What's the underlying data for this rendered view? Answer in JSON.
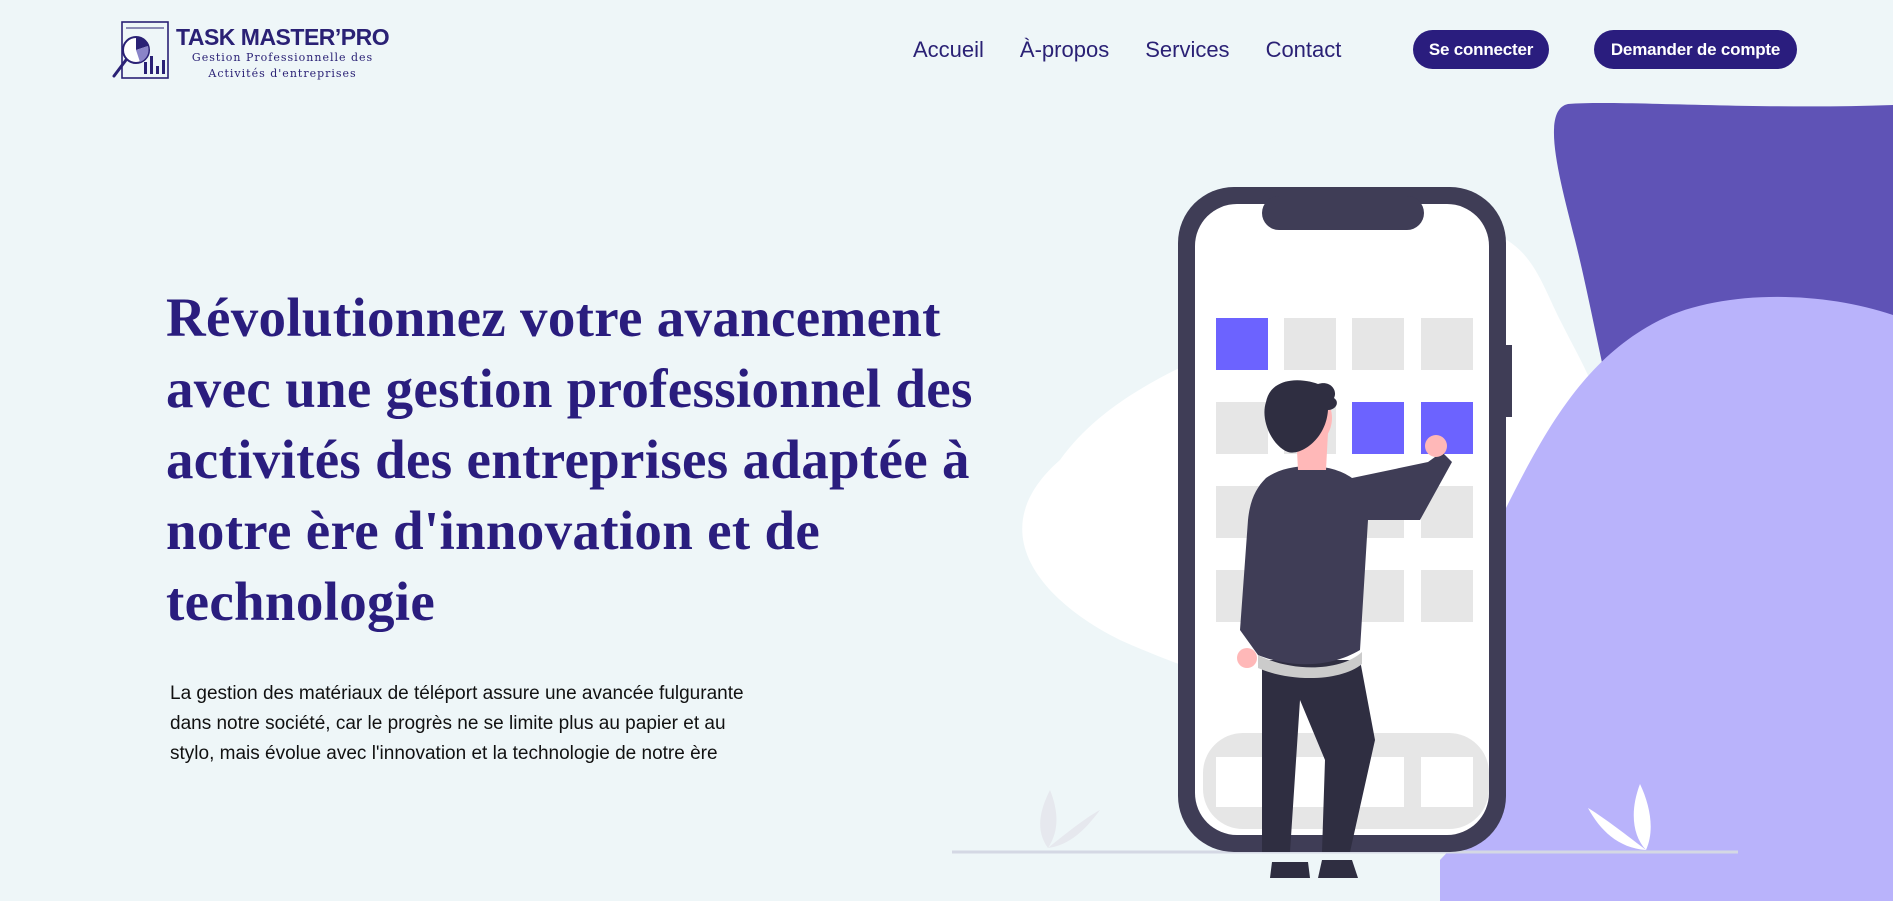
{
  "brand": {
    "title": "TASK MASTER’PRO",
    "subtitle_line1": "Gestion Professionnelle des",
    "subtitle_line2": "Activités  d'entreprises"
  },
  "nav": {
    "items": [
      {
        "label": "Accueil"
      },
      {
        "label": "À-propos"
      },
      {
        "label": "Services"
      },
      {
        "label": "Contact"
      }
    ],
    "login_label": "Se connecter",
    "request_label": "Demander de compte"
  },
  "hero": {
    "title": "Révolutionnez votre avancement avec une gestion professionnel des activités des entreprises adaptée à notre ère d'innovation et de technologie",
    "description": "La gestion des matériaux de téléport assure une avancée fulgurante dans notre société, car le progrès ne se limite plus au papier et au stylo, mais évolue avec l'innovation et la technologie de notre ère"
  },
  "colors": {
    "primary": "#2a1d7e",
    "background": "#eef6f8",
    "accent_dark_blob": "#5f53b6",
    "accent_light_blob": "#b9b3fb",
    "tile_active": "#6c63ff"
  },
  "icons": {
    "logo": "analytics-magnifier-logo"
  }
}
